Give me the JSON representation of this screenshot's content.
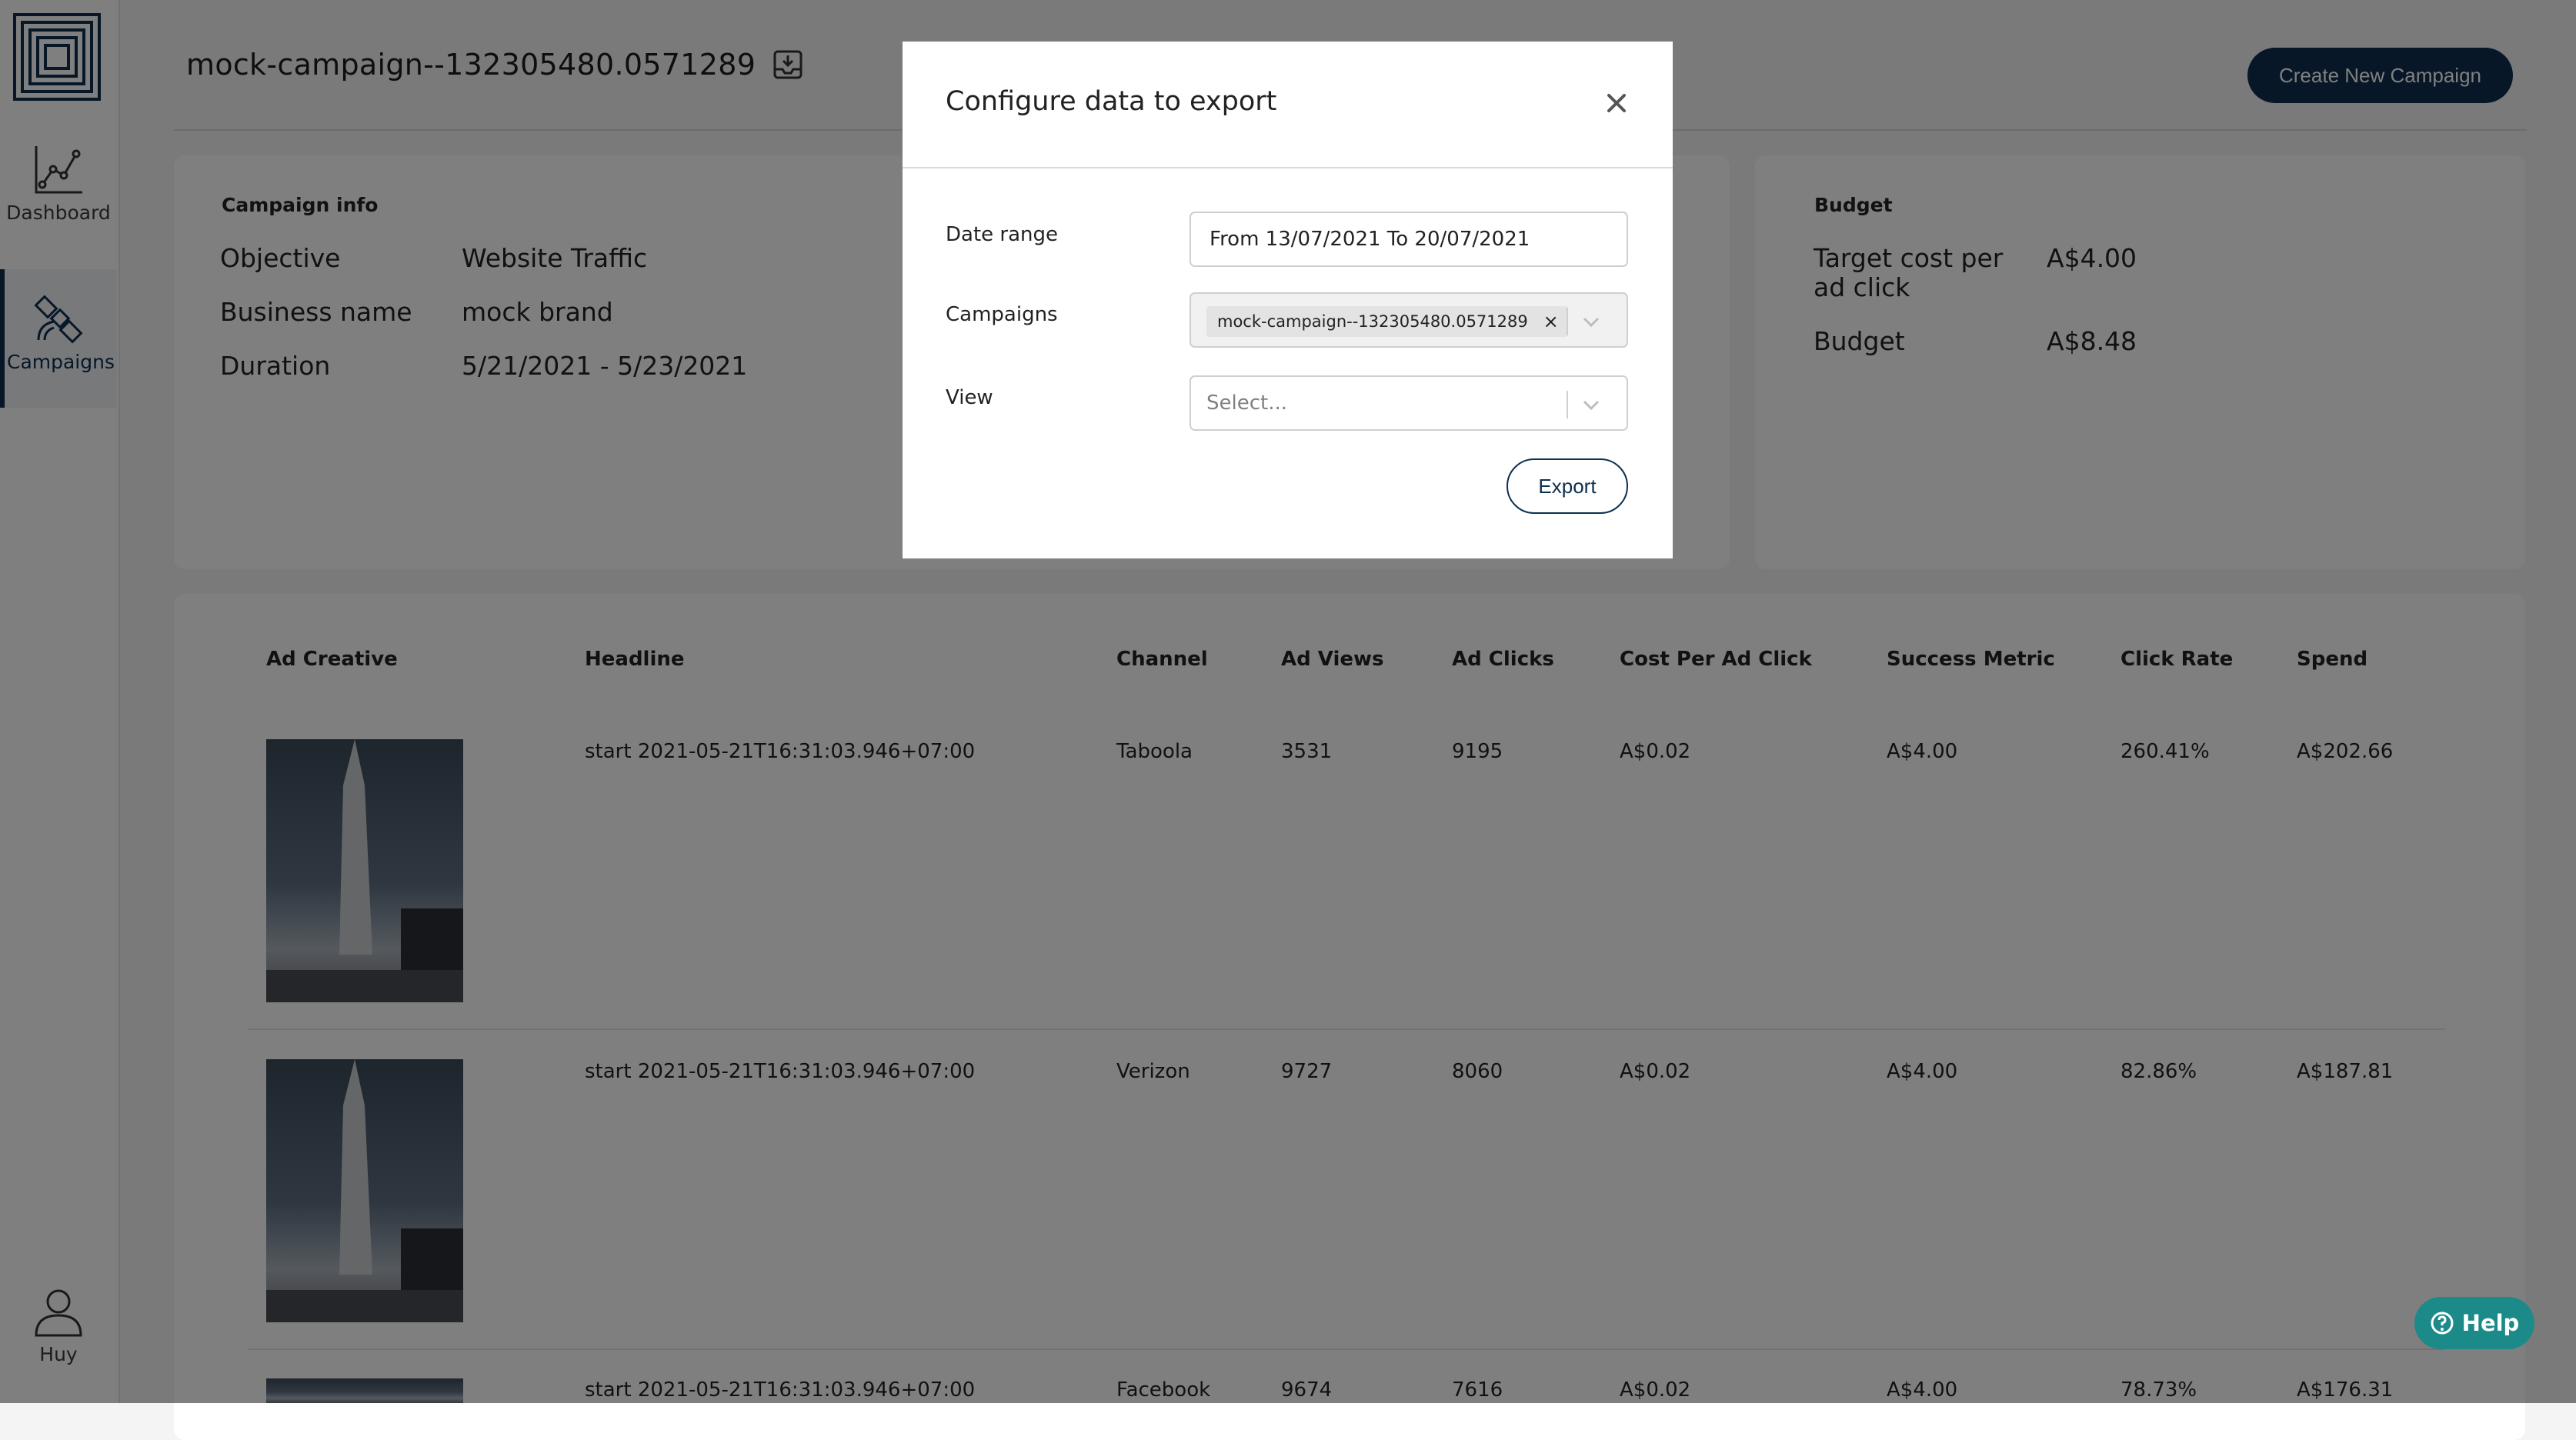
{
  "sidebar": {
    "items": [
      {
        "label": "Dashboard"
      },
      {
        "label": "Campaigns"
      },
      {
        "label": "Huy"
      }
    ]
  },
  "header": {
    "title": "mock-campaign--132305480.0571289",
    "create_button": "Create New Campaign"
  },
  "campaign_info": {
    "heading": "Campaign info",
    "rows": [
      {
        "label": "Objective",
        "value": "Website Traffic"
      },
      {
        "label": "Business name",
        "value": "mock brand"
      },
      {
        "label": "Duration",
        "value": "5/21/2021 - 5/23/2021"
      }
    ]
  },
  "budget": {
    "heading": "Budget",
    "rows": [
      {
        "label_line1": "Target cost per",
        "label_line2": "ad click",
        "value": "A$4.00"
      },
      {
        "label_line1": "Budget",
        "value": "A$8.48"
      }
    ]
  },
  "table": {
    "headers": [
      "Ad Creative",
      "Headline",
      "Channel",
      "Ad Views",
      "Ad Clicks",
      "Cost Per Ad Click",
      "Success Metric",
      "Click Rate",
      "Spend"
    ],
    "rows": [
      {
        "headline": "start 2021-05-21T16:31:03.946+07:00",
        "channel": "Taboola",
        "views": "3531",
        "clicks": "9195",
        "cpc": "A$0.02",
        "metric": "A$4.00",
        "rate": "260.41%",
        "spend": "A$202.66"
      },
      {
        "headline": "start 2021-05-21T16:31:03.946+07:00",
        "channel": "Verizon",
        "views": "9727",
        "clicks": "8060",
        "cpc": "A$0.02",
        "metric": "A$4.00",
        "rate": "82.86%",
        "spend": "A$187.81"
      },
      {
        "headline": "start 2021-05-21T16:31:03.946+07:00",
        "channel": "Facebook",
        "views": "9674",
        "clicks": "7616",
        "cpc": "A$0.02",
        "metric": "A$4.00",
        "rate": "78.73%",
        "spend": "A$176.31"
      }
    ]
  },
  "modal": {
    "title": "Configure data to export",
    "date_label": "Date range",
    "date_value": "From 13/07/2021  To 20/07/2021",
    "campaigns_label": "Campaigns",
    "campaign_chip": "mock-campaign--132305480.0571289",
    "chip_remove": "×",
    "view_label": "View",
    "view_placeholder": "Select...",
    "export_button": "Export"
  },
  "help": {
    "label": "Help"
  },
  "colors": {
    "primary": "#0e2f4e",
    "help": "#1d8a8a",
    "overlay": "rgba(0,0,0,0.5)"
  }
}
